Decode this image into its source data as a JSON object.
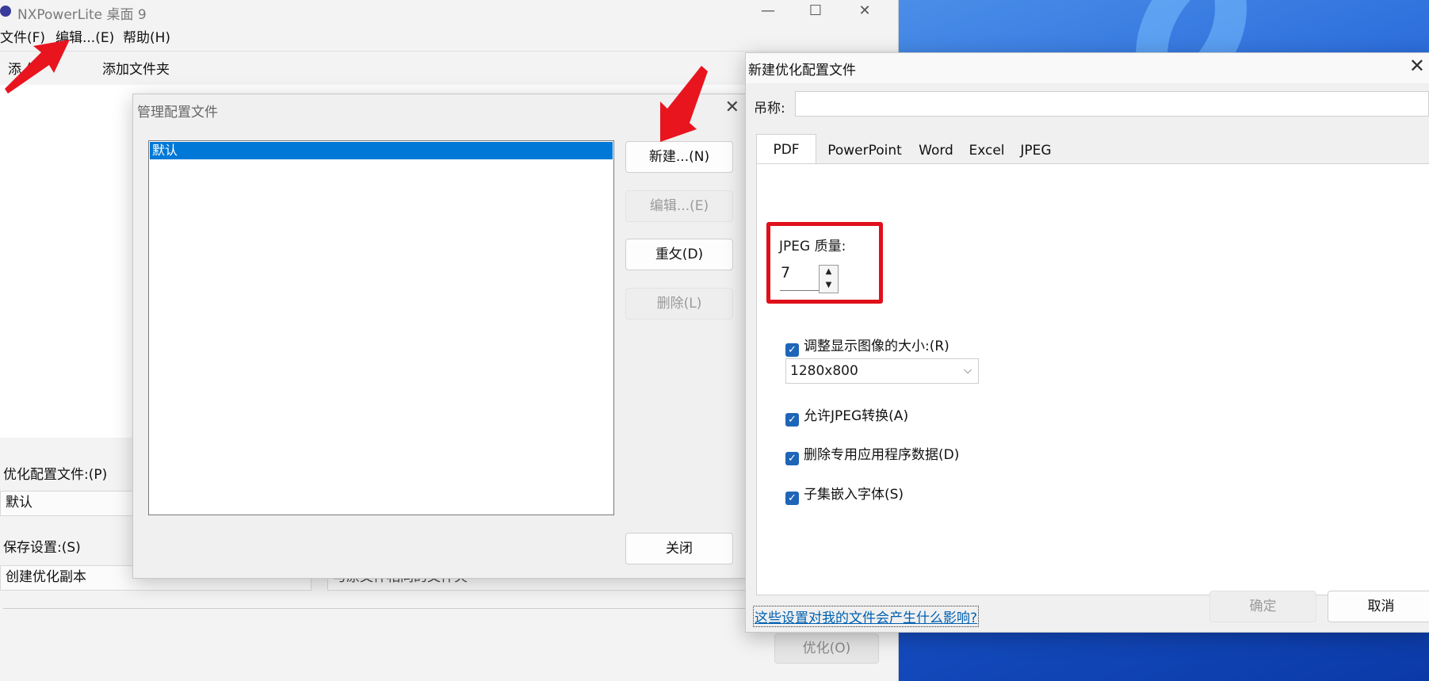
{
  "main_window": {
    "title": "NXPowerLite 桌面 9",
    "menu": [
      "文件(F)",
      "编辑...(E)",
      "帮助(H)"
    ],
    "toolbar": {
      "add_file": "添加文件",
      "add_file_visible": "添 件",
      "add_folder": "添加文件夹"
    },
    "profile_label": "优化配置文件:(P)",
    "profile_value": "默认",
    "save_label": "保存设置:(S)",
    "save_value": "创建优化副本",
    "save_location_value": "与原文件相同的文件夹",
    "optimize_button": "优化(O)",
    "window_controls": {
      "minimize": "—",
      "maximize": "☐",
      "close": "✕"
    }
  },
  "manage_dialog": {
    "title": "管理配置文件",
    "profiles": [
      "默认"
    ],
    "buttons": {
      "new": "新建...(N)",
      "edit": "编辑...(E)",
      "rename": "重攵(D)",
      "delete": "删除(L)",
      "close": "关闭"
    },
    "close_icon": "✕"
  },
  "new_dialog": {
    "title": "新建优化配置文件",
    "name_label": "吊称:",
    "name_value": "",
    "tabs": [
      "PDF",
      "PowerPoint",
      "Word",
      "Excel",
      "JPEG"
    ],
    "active_tab": "PDF",
    "jpeg_quality_label": "JPEG 质量:",
    "jpeg_quality_value": "7",
    "resize_label": "调整显示图像的大小:(R)",
    "resize_checked": true,
    "resize_value": "1280x800",
    "allow_jpeg_label": "允许JPEG转换(A)",
    "allow_jpeg_checked": true,
    "remove_app_data_label": "删除专用应用程序数据(D)",
    "remove_app_data_checked": true,
    "subset_fonts_label": "子集嵌入字体(S)",
    "subset_fonts_checked": true,
    "help_link": "这些设置对我的文件会产生什么影响?",
    "ok_button": "确定",
    "cancel_button": "取消",
    "close_icon": "✕"
  },
  "colors": {
    "accent": "#0078d7",
    "highlight": "#e0101a",
    "arrow": "#e8151f",
    "checkbox": "#1f65b7"
  }
}
